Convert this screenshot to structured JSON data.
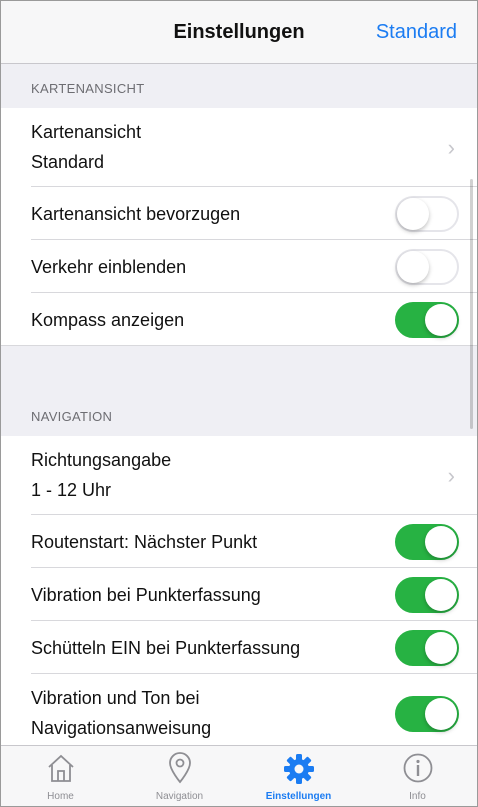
{
  "header": {
    "title": "Einstellungen",
    "right_button": "Standard"
  },
  "sections": {
    "map": {
      "header": "KARTENANSICHT",
      "map_view_label": "Kartenansicht",
      "map_view_value": "Standard",
      "prefer_map_view": {
        "label": "Kartenansicht bevorzugen",
        "on": false
      },
      "show_traffic": {
        "label": "Verkehr einblenden",
        "on": false
      },
      "show_compass": {
        "label": "Kompass anzeigen",
        "on": true
      }
    },
    "navigation": {
      "header": "NAVIGATION",
      "direction_label": "Richtungsangabe",
      "direction_value": "1 - 12 Uhr",
      "route_start": {
        "label": "Routenstart: Nächster Punkt",
        "on": true
      },
      "vibration_capture": {
        "label": "Vibration bei Punkterfassung",
        "on": true
      },
      "shake_capture": {
        "label": "Schütteln EIN bei Punkterfassung",
        "on": true
      },
      "vibration_sound_1": "Vibration und Ton bei",
      "vibration_sound_2": "Navigationsanweisung",
      "vibration_sound_on": true
    }
  },
  "tabs": [
    {
      "label": "Home",
      "icon": "home-icon",
      "active": false
    },
    {
      "label": "Navigation",
      "icon": "location-pin-icon",
      "active": false
    },
    {
      "label": "Einstellungen",
      "icon": "gear-icon",
      "active": true
    },
    {
      "label": "Info",
      "icon": "info-icon",
      "active": false
    }
  ],
  "colors": {
    "accent": "#1b7cf2",
    "toggle_on": "#27b243",
    "inactive_tab": "#8e8e93"
  }
}
